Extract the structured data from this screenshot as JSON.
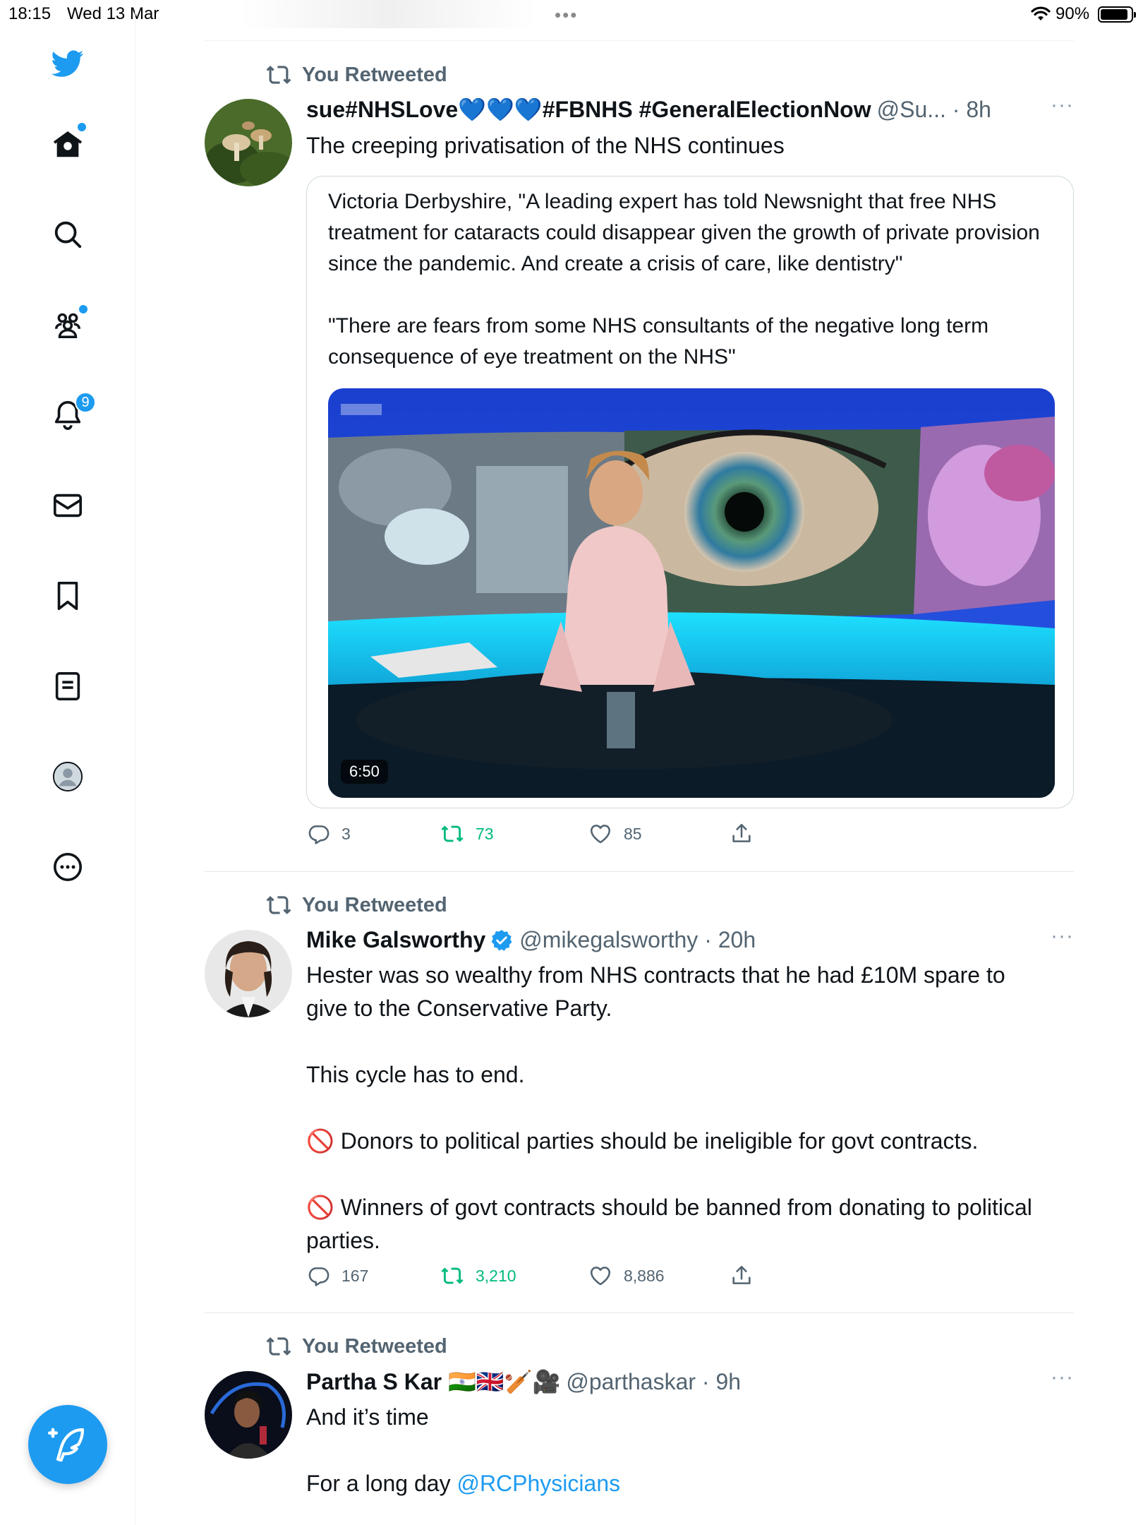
{
  "status_bar": {
    "time": "18:15",
    "date": "Wed 13 Mar",
    "battery": "90%",
    "battery_level": 0.9,
    "dots": "•••"
  },
  "sidebar": {
    "items": [
      {
        "name": "home",
        "icon": "home-icon",
        "has_dot": true
      },
      {
        "name": "explore",
        "icon": "search-icon"
      },
      {
        "name": "communities",
        "icon": "communities-icon",
        "has_dot": true
      },
      {
        "name": "notifications",
        "icon": "bell-icon",
        "badge": "9"
      },
      {
        "name": "messages",
        "icon": "mail-icon"
      },
      {
        "name": "bookmarks",
        "icon": "bookmark-icon"
      },
      {
        "name": "lists",
        "icon": "list-icon"
      },
      {
        "name": "profile",
        "icon": "profile-icon"
      },
      {
        "name": "more",
        "icon": "more-circle-icon"
      }
    ],
    "compose_icon": "compose-tweet-icon"
  },
  "tweets": [
    {
      "retweet_label": "You Retweeted",
      "name": "sue#NHSLove💙💙💙#FBNHS #GeneralElectionNow",
      "handle": "@Su... · 8h",
      "text": [
        "The creeping privatisation of the NHS continues"
      ],
      "quote": {
        "text": [
          "Victoria Derbyshire, \"A leading expert has told Newsnight that free NHS treatment for cataracts could disappear given the growth of private provision since the pandemic. And create a crisis of care, like dentistry\"",
          "",
          "\"There are fears from some NHS consultants of the negative long term consequence of eye treatment on the NHS\""
        ],
        "video_duration": "6:50",
        "video_logo": "BBC"
      },
      "stats": {
        "replies": "3",
        "retweets": "73",
        "likes": "85"
      }
    },
    {
      "retweet_label": "You Retweeted",
      "name": "Mike Galsworthy",
      "verified": true,
      "handle": "@mikegalsworthy · 20h",
      "text": [
        "Hester was so wealthy from NHS contracts that he had £10M spare to give to the Conservative Party.",
        "",
        "This cycle has to end.",
        "",
        "🚫 Donors to political parties should be ineligible for govt contracts.",
        "",
        "🚫 Winners of govt contracts should be banned from donating to political parties."
      ],
      "stats": {
        "replies": "167",
        "retweets": "3,210",
        "likes": "8,886"
      }
    },
    {
      "retweet_label": "You Retweeted",
      "name": "Partha S Kar 🇮🇳🇬🇧🏏🎥",
      "handle": "@parthaskar · 9h",
      "text_line1": "And it’s time",
      "text_line2_prefix": "For a long day ",
      "text_line2_link": "@RCPhysicians"
    }
  ],
  "more_dots": "···",
  "colors": {
    "accent": "#1d9bf0",
    "retweet_green": "#00ba7c",
    "secondary": "#536471"
  }
}
